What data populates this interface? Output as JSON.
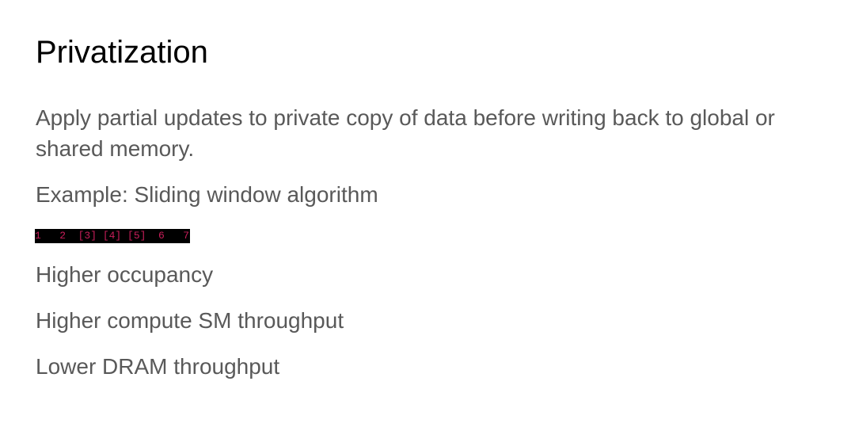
{
  "slide": {
    "title": "Privatization",
    "description": "Apply partial updates to private copy of data before writing back to global or shared memory.",
    "example": "Example: Sliding window algorithm",
    "code_line": "1   2  [3] [4] [5]  6   7",
    "points": [
      "Higher occupancy",
      "Higher compute SM throughput",
      "Lower DRAM throughput"
    ]
  },
  "colors": {
    "title_text": "#000000",
    "body_text": "#595959",
    "code_background": "#000000",
    "code_text": "#c81e5a"
  }
}
